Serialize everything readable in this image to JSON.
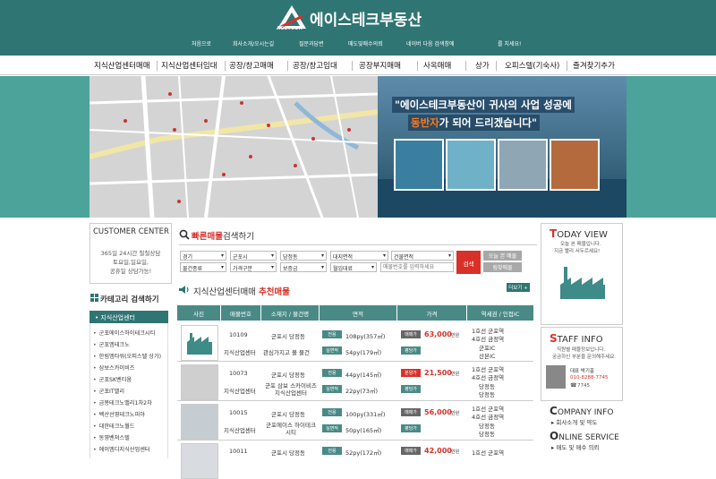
{
  "header": {
    "brand": "에이스테크부동산",
    "brand_sub": "ACETECH",
    "topnav": [
      "처음으로",
      "회사소개/오시는길",
      "질문과답변",
      "매도및매수의뢰",
      "네이버 다음 검색창에",
      "를 치세요!"
    ]
  },
  "mainnav": [
    "지식산업센터매매",
    "지식산업센터임대",
    "공장/창고매매",
    "공장/창고임대",
    "공장부지매매",
    "사옥매매",
    "상가",
    "오피스텔(기숙사)",
    "즐겨찾기추가"
  ],
  "banner": {
    "slogan_line1": "\"에이스테크부동산이 귀사의 사업 성공에",
    "slogan_hl": "동반자",
    "slogan_line2_rest": "가 되어 드리겠습니다\""
  },
  "customer_center": {
    "title": "CUSTOMER CENTER",
    "lines": [
      "365일 24시간 철철상담",
      "토요일,일요일,",
      "공휴일 상담가능!"
    ]
  },
  "category": {
    "title": "카테고리 검색하기",
    "active": "지식산업센터",
    "items": [
      "군포에이스하이테크시티",
      "군포엠테크노",
      "한림엠타워(오피스텔 상가)",
      "삼보스카이비즈",
      "군포SK벤티움",
      "군포IT밸리",
      "금봉테크노밸리1차2차",
      "벡산선영테크노피아",
      "대한테크노월드",
      "동영벤쳐스텔",
      "에이엠디지식산업센터"
    ]
  },
  "search": {
    "title_hl": "빠른매물",
    "title_rest": "검색하기",
    "row1": [
      "경기",
      "군포시",
      "당정동",
      "대지면적",
      "건물면적"
    ],
    "row2": [
      "물건종류",
      "가격구분",
      "보증금",
      "월임대료"
    ],
    "input_placeholder": "매물번호를 입력하세요",
    "button": "검색",
    "btn_today": "오늘 본 매물",
    "btn_reset": "림찾매물"
  },
  "recommend": {
    "title_prefix": "지식산업센터매매",
    "title_hl": "추천매물",
    "more": "더보기 +",
    "columns": [
      "사진",
      "매물번호",
      "소재지 / 물건명",
      "면적",
      "가격",
      "역세권 / 인접IC"
    ],
    "rows": [
      {
        "id": "10109",
        "name": "지식산업센터",
        "loc1": "군포시 당정동",
        "loc2": "관심가지고 볼 물건",
        "area1_tag": "전용",
        "area1": "108py(357㎡)",
        "area2_tag": "실면적",
        "area2": "54py(179㎡)",
        "price_tag": "매매가",
        "price": "63,000",
        "price_unit": "만원",
        "price2_tag": "평당가",
        "price2": "",
        "station1": "1호선 군포역",
        "station2": "4호선 금정역",
        "station3": "군포IC",
        "station4": "산본IC"
      },
      {
        "id": "10073",
        "name": "지식산업센터",
        "loc1": "군포시 당정동",
        "loc2": "군포 삼보 스카이비즈 지식산업센터",
        "area1_tag": "전용",
        "area1": "44py(145㎡)",
        "area2_tag": "실면적",
        "area2": "22py(73㎡)",
        "price_tag": "분양가",
        "price": "21,500",
        "price_unit": "만원",
        "price2_tag": "평당가",
        "price2": "",
        "station1": "1호선 군포역",
        "station2": "4호선 금정역",
        "station3": "당정동",
        "station4": "당정동"
      },
      {
        "id": "10015",
        "name": "지식산업센터",
        "loc1": "군포시 당정동",
        "loc2": "군포에이스 하이테크 시티",
        "area1_tag": "전용",
        "area1": "100py(331㎡)",
        "area2_tag": "실면적",
        "area2": "50py(165㎡)",
        "price_tag": "매매가",
        "price": "56,000",
        "price_unit": "만원",
        "price2_tag": "평당가",
        "price2": "",
        "station1": "1호선 군포역",
        "station2": "4호선 금정역",
        "station3": "당정동",
        "station4": "당정동"
      },
      {
        "id": "10011",
        "name": "",
        "loc1": "군포시 당정동",
        "loc2": "",
        "area1_tag": "전용",
        "area1": "52py(172㎡)",
        "area2_tag": "",
        "area2": "",
        "price_tag": "매매가",
        "price": "42,000",
        "price_unit": "만원",
        "price2_tag": "",
        "price2": "",
        "station1": "1호선 군포역",
        "station2": "",
        "station3": "",
        "station4": ""
      }
    ]
  },
  "today_view": {
    "title_cap": "T",
    "title_rest": "ODAY VIEW",
    "line1": "오늘 본 매물입니다.",
    "line2": "지금 빨리 서두르세요!"
  },
  "staff_info": {
    "title_cap": "S",
    "title_rest": "TAFF INFO",
    "line1": "직원별 매물정보입니다.",
    "line2": "궁금하신 부분을 문의해주세요.",
    "name": "대표 박기홍",
    "phone": "010-8288-7745",
    "ext": "7745"
  },
  "company_info": {
    "title_cap": "C",
    "title_rest": "OMPANY INFO",
    "item": "회사소개 및 약도"
  },
  "online_service": {
    "title_cap": "O",
    "title_rest": "NLINE SERVICE",
    "item": "매도 및 매수 의뢰"
  },
  "colors": {
    "teal": "#2f7573",
    "teal_light": "#4ba399",
    "red": "#d8312a"
  }
}
